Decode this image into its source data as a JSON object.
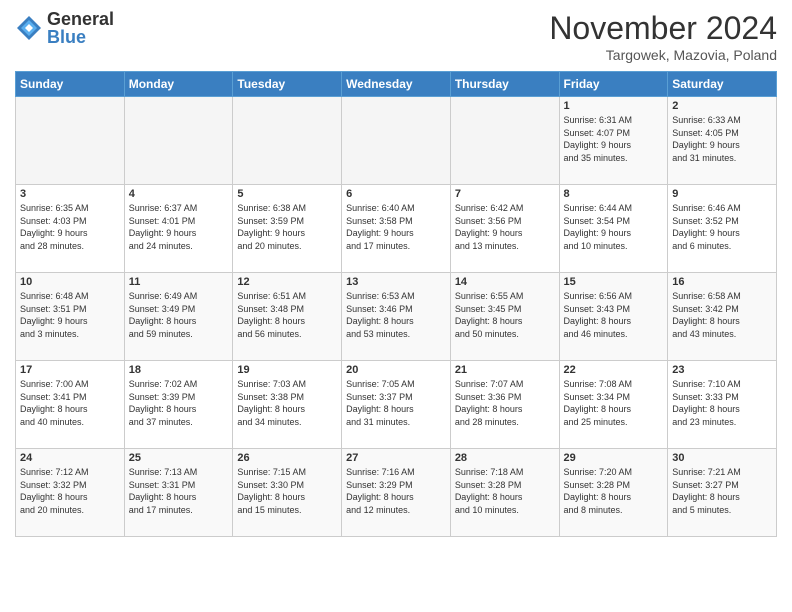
{
  "logo": {
    "general": "General",
    "blue": "Blue"
  },
  "title": "November 2024",
  "subtitle": "Targowek, Mazovia, Poland",
  "days_header": [
    "Sunday",
    "Monday",
    "Tuesday",
    "Wednesday",
    "Thursday",
    "Friday",
    "Saturday"
  ],
  "weeks": [
    [
      {
        "day": "",
        "info": ""
      },
      {
        "day": "",
        "info": ""
      },
      {
        "day": "",
        "info": ""
      },
      {
        "day": "",
        "info": ""
      },
      {
        "day": "",
        "info": ""
      },
      {
        "day": "1",
        "info": "Sunrise: 6:31 AM\nSunset: 4:07 PM\nDaylight: 9 hours\nand 35 minutes."
      },
      {
        "day": "2",
        "info": "Sunrise: 6:33 AM\nSunset: 4:05 PM\nDaylight: 9 hours\nand 31 minutes."
      }
    ],
    [
      {
        "day": "3",
        "info": "Sunrise: 6:35 AM\nSunset: 4:03 PM\nDaylight: 9 hours\nand 28 minutes."
      },
      {
        "day": "4",
        "info": "Sunrise: 6:37 AM\nSunset: 4:01 PM\nDaylight: 9 hours\nand 24 minutes."
      },
      {
        "day": "5",
        "info": "Sunrise: 6:38 AM\nSunset: 3:59 PM\nDaylight: 9 hours\nand 20 minutes."
      },
      {
        "day": "6",
        "info": "Sunrise: 6:40 AM\nSunset: 3:58 PM\nDaylight: 9 hours\nand 17 minutes."
      },
      {
        "day": "7",
        "info": "Sunrise: 6:42 AM\nSunset: 3:56 PM\nDaylight: 9 hours\nand 13 minutes."
      },
      {
        "day": "8",
        "info": "Sunrise: 6:44 AM\nSunset: 3:54 PM\nDaylight: 9 hours\nand 10 minutes."
      },
      {
        "day": "9",
        "info": "Sunrise: 6:46 AM\nSunset: 3:52 PM\nDaylight: 9 hours\nand 6 minutes."
      }
    ],
    [
      {
        "day": "10",
        "info": "Sunrise: 6:48 AM\nSunset: 3:51 PM\nDaylight: 9 hours\nand 3 minutes."
      },
      {
        "day": "11",
        "info": "Sunrise: 6:49 AM\nSunset: 3:49 PM\nDaylight: 8 hours\nand 59 minutes."
      },
      {
        "day": "12",
        "info": "Sunrise: 6:51 AM\nSunset: 3:48 PM\nDaylight: 8 hours\nand 56 minutes."
      },
      {
        "day": "13",
        "info": "Sunrise: 6:53 AM\nSunset: 3:46 PM\nDaylight: 8 hours\nand 53 minutes."
      },
      {
        "day": "14",
        "info": "Sunrise: 6:55 AM\nSunset: 3:45 PM\nDaylight: 8 hours\nand 50 minutes."
      },
      {
        "day": "15",
        "info": "Sunrise: 6:56 AM\nSunset: 3:43 PM\nDaylight: 8 hours\nand 46 minutes."
      },
      {
        "day": "16",
        "info": "Sunrise: 6:58 AM\nSunset: 3:42 PM\nDaylight: 8 hours\nand 43 minutes."
      }
    ],
    [
      {
        "day": "17",
        "info": "Sunrise: 7:00 AM\nSunset: 3:41 PM\nDaylight: 8 hours\nand 40 minutes."
      },
      {
        "day": "18",
        "info": "Sunrise: 7:02 AM\nSunset: 3:39 PM\nDaylight: 8 hours\nand 37 minutes."
      },
      {
        "day": "19",
        "info": "Sunrise: 7:03 AM\nSunset: 3:38 PM\nDaylight: 8 hours\nand 34 minutes."
      },
      {
        "day": "20",
        "info": "Sunrise: 7:05 AM\nSunset: 3:37 PM\nDaylight: 8 hours\nand 31 minutes."
      },
      {
        "day": "21",
        "info": "Sunrise: 7:07 AM\nSunset: 3:36 PM\nDaylight: 8 hours\nand 28 minutes."
      },
      {
        "day": "22",
        "info": "Sunrise: 7:08 AM\nSunset: 3:34 PM\nDaylight: 8 hours\nand 25 minutes."
      },
      {
        "day": "23",
        "info": "Sunrise: 7:10 AM\nSunset: 3:33 PM\nDaylight: 8 hours\nand 23 minutes."
      }
    ],
    [
      {
        "day": "24",
        "info": "Sunrise: 7:12 AM\nSunset: 3:32 PM\nDaylight: 8 hours\nand 20 minutes."
      },
      {
        "day": "25",
        "info": "Sunrise: 7:13 AM\nSunset: 3:31 PM\nDaylight: 8 hours\nand 17 minutes."
      },
      {
        "day": "26",
        "info": "Sunrise: 7:15 AM\nSunset: 3:30 PM\nDaylight: 8 hours\nand 15 minutes."
      },
      {
        "day": "27",
        "info": "Sunrise: 7:16 AM\nSunset: 3:29 PM\nDaylight: 8 hours\nand 12 minutes."
      },
      {
        "day": "28",
        "info": "Sunrise: 7:18 AM\nSunset: 3:28 PM\nDaylight: 8 hours\nand 10 minutes."
      },
      {
        "day": "29",
        "info": "Sunrise: 7:20 AM\nSunset: 3:28 PM\nDaylight: 8 hours\nand 8 minutes."
      },
      {
        "day": "30",
        "info": "Sunrise: 7:21 AM\nSunset: 3:27 PM\nDaylight: 8 hours\nand 5 minutes."
      }
    ]
  ]
}
